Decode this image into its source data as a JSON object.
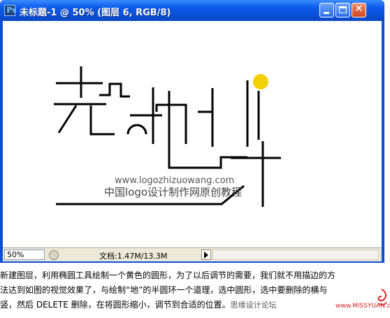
{
  "window": {
    "title": "未标题-1 @ 50% (图层 6, RGB/8)",
    "icon": "photoshop-document-icon",
    "icon_letter": "Ps"
  },
  "artwork": {
    "watermark_url": "www.logozhizuowang.com",
    "watermark_text": "中国logo设计制作网原创教程",
    "accent_color": "#f2d000"
  },
  "status": {
    "zoom": "50%",
    "doc_info": "文档:1.47M/13.3M"
  },
  "caption": {
    "line1": "新建图层，利用椭圆工具绘制一个黄色的圆形，为了以后调节的需要，我们就不用描边的方",
    "line2": "法达到如图的视觉效果了，与绘制“地”的半圆环一个道理，选中圆形，选中要删除的横与",
    "line3": "竖，然后 DELETE 删除，在将圆形缩小，调节到合适的位置。",
    "watermark_left": "思缘设计论坛",
    "watermark_right": "www.MISSYUAN.com"
  }
}
